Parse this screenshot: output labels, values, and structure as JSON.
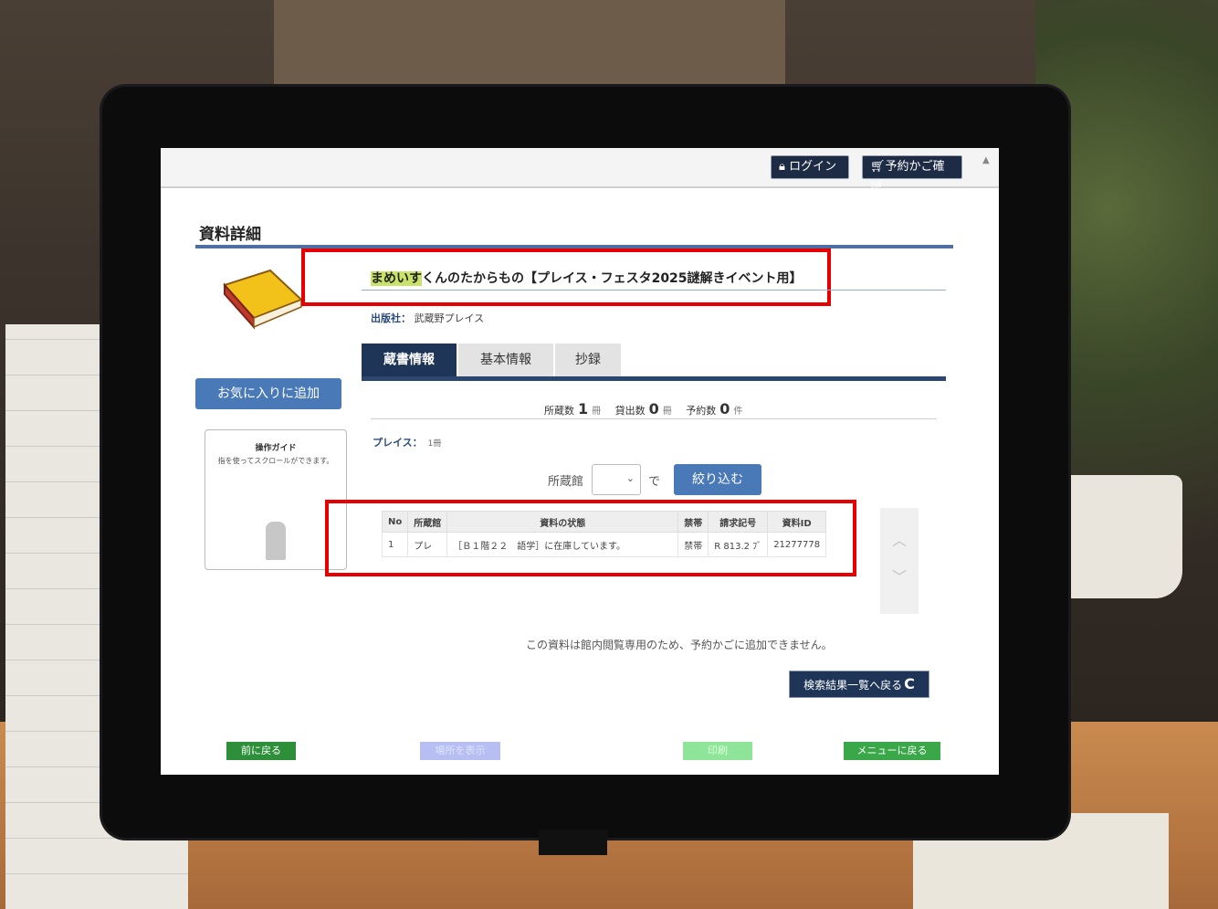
{
  "topbar": {
    "login_label": "ログイン",
    "cart_label": "予約かご確認"
  },
  "page": {
    "title": "資料詳細"
  },
  "book": {
    "title_highlight": "まめいす",
    "title_rest": "くんのたからもの【プレイス・フェスタ2025謎解きイベント用】",
    "publisher_label": "出版社：",
    "publisher_value": "武蔵野プレイス"
  },
  "tabs": [
    {
      "label": "蔵書情報",
      "active": true
    },
    {
      "label": "基本情報",
      "active": false
    },
    {
      "label": "抄録",
      "active": false
    }
  ],
  "favorite_button": "お気に入りに追加",
  "guide": {
    "title": "操作ガイド",
    "text": "指を使ってスクロールができます。"
  },
  "counts": {
    "held_label": "所蔵数",
    "held_value": "1",
    "held_unit": "冊",
    "loaned_label": "貸出数",
    "loaned_value": "0",
    "loaned_unit": "冊",
    "reserved_label": "予約数",
    "reserved_value": "0",
    "reserved_unit": "件"
  },
  "branch_summary": {
    "name": "プレイス：",
    "count": "1冊"
  },
  "filter": {
    "label": "所蔵館",
    "suffix": "で",
    "button": "絞り込む"
  },
  "holdings": {
    "headers": [
      "No",
      "所蔵館",
      "資料の状態",
      "禁帯",
      "請求記号",
      "資料ID"
    ],
    "rows": [
      [
        "1",
        "プレ",
        "［Ｂ１階２２　語学］に在庫しています。",
        "禁帯",
        "R 813.2 ﾌﾞ",
        "21277778"
      ]
    ]
  },
  "notice": "この資料は館内閲覧専用のため、予約かごに追加できません。",
  "back_results_button": "検索結果一覧へ戻る",
  "footer": {
    "prev": "前に戻る",
    "location": "場所を表示",
    "print": "印刷",
    "menu": "メニューに戻る"
  },
  "colors": {
    "highlight_box": "#e60000",
    "header_navy": "#1f3558",
    "accent_blue": "#4a79b8",
    "title_marker": "#c9e26a",
    "footer_green": "#3aa848"
  }
}
